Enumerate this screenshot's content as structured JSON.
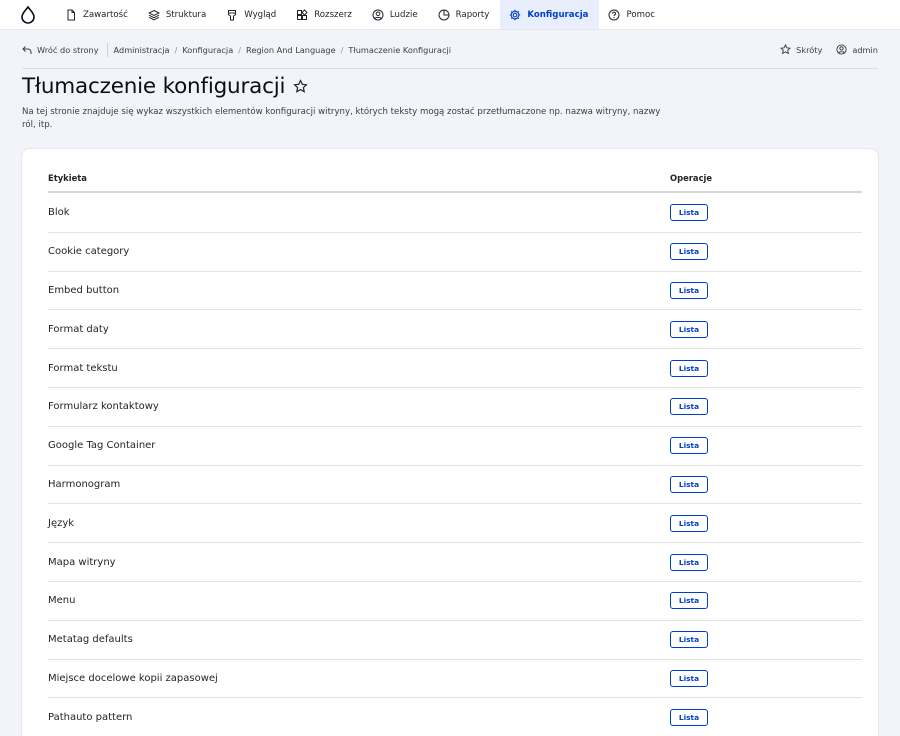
{
  "toolbar": {
    "items": [
      {
        "label": "Zawartość",
        "icon": "file-icon"
      },
      {
        "label": "Struktura",
        "icon": "layers-icon"
      },
      {
        "label": "Wygląd",
        "icon": "paint-bucket-icon"
      },
      {
        "label": "Rozszerz",
        "icon": "puzzle-icon"
      },
      {
        "label": "Ludzie",
        "icon": "user-circle-icon"
      },
      {
        "label": "Raporty",
        "icon": "pie-chart-icon"
      },
      {
        "label": "Konfiguracja",
        "icon": "gear-icon",
        "active": true
      },
      {
        "label": "Pomoc",
        "icon": "help-circle-icon"
      }
    ]
  },
  "breadcrumb": {
    "back_label": "Wróć do strony",
    "items": [
      "Administracja",
      "Konfiguracja",
      "Region And Language",
      "Tłumaczenie Konfiguracji"
    ],
    "shortcuts_label": "Skróty",
    "user_label": "admin"
  },
  "page": {
    "title": "Tłumaczenie konfiguracji",
    "description": "Na tej stronie znajduje się wykaz wszystkich elementów konfiguracji witryny, których teksty mogą zostać przetłumaczone np. nazwa witryny, nazwy ról, itp."
  },
  "table": {
    "headers": {
      "label": "Etykieta",
      "operations": "Operacje"
    },
    "button_label": "Lista",
    "rows": [
      "Blok",
      "Cookie category",
      "Embed button",
      "Format daty",
      "Format tekstu",
      "Formularz kontaktowy",
      "Google Tag Container",
      "Harmonogram",
      "Język",
      "Mapa witryny",
      "Menu",
      "Metatag defaults",
      "Miejsce docelowe kopii zapasowej",
      "Pathauto pattern"
    ]
  },
  "colors": {
    "accent": "#003ecc",
    "active_tab_bg": "#e9eefc",
    "page_bg": "#f3f4f9"
  }
}
